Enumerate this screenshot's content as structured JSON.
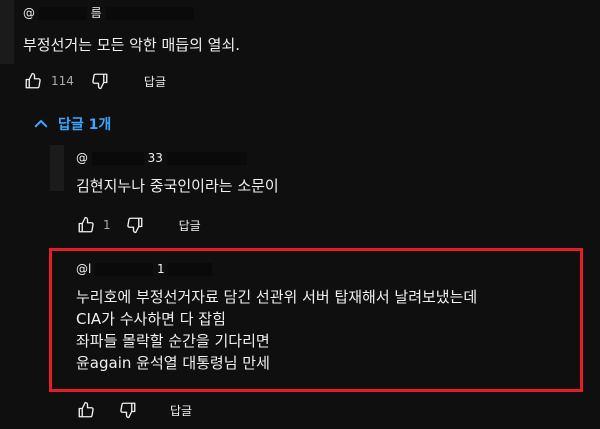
{
  "top_comment": {
    "author_prefix": "@",
    "author_suffix": "름",
    "text": "부정선거는 모든 악한 매듭의 열쇠.",
    "likes": "114",
    "reply_label": "답글"
  },
  "replies_toggle": {
    "label": "답글 1개"
  },
  "replies": [
    {
      "author_prefix": "@",
      "author_suffix": "33",
      "text": "김현지누나 중국인이라는 소문이",
      "likes": "1",
      "reply_label": "답글"
    },
    {
      "author_prefix": "@l",
      "author_suffix": "1",
      "lines": [
        "누리호에 부정선거자료 담긴 선관위 서버 탑재해서 날려보냈는데",
        "CIA가 수사하면 다 잡힘",
        "좌파들 몰락할 순간을 기다리면",
        "윤again 윤석열 대통령님 만세"
      ],
      "reply_label": "답글"
    }
  ],
  "colors": {
    "accent": "#3ea6ff",
    "highlight": "#e61d25",
    "background": "#0f0f0f"
  },
  "icons": [
    "thumbs-up-icon",
    "thumbs-down-icon",
    "chevron-up-icon"
  ]
}
